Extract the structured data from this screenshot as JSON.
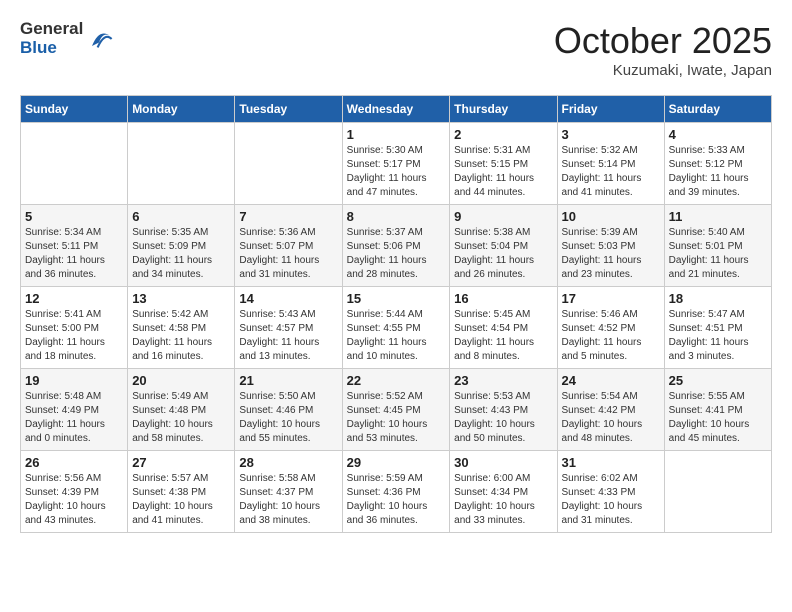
{
  "header": {
    "logo_line1": "General",
    "logo_line2": "Blue",
    "month": "October 2025",
    "location": "Kuzumaki, Iwate, Japan"
  },
  "days_of_week": [
    "Sunday",
    "Monday",
    "Tuesday",
    "Wednesday",
    "Thursday",
    "Friday",
    "Saturday"
  ],
  "weeks": [
    [
      {
        "num": "",
        "info": ""
      },
      {
        "num": "",
        "info": ""
      },
      {
        "num": "",
        "info": ""
      },
      {
        "num": "1",
        "info": "Sunrise: 5:30 AM\nSunset: 5:17 PM\nDaylight: 11 hours\nand 47 minutes."
      },
      {
        "num": "2",
        "info": "Sunrise: 5:31 AM\nSunset: 5:15 PM\nDaylight: 11 hours\nand 44 minutes."
      },
      {
        "num": "3",
        "info": "Sunrise: 5:32 AM\nSunset: 5:14 PM\nDaylight: 11 hours\nand 41 minutes."
      },
      {
        "num": "4",
        "info": "Sunrise: 5:33 AM\nSunset: 5:12 PM\nDaylight: 11 hours\nand 39 minutes."
      }
    ],
    [
      {
        "num": "5",
        "info": "Sunrise: 5:34 AM\nSunset: 5:11 PM\nDaylight: 11 hours\nand 36 minutes."
      },
      {
        "num": "6",
        "info": "Sunrise: 5:35 AM\nSunset: 5:09 PM\nDaylight: 11 hours\nand 34 minutes."
      },
      {
        "num": "7",
        "info": "Sunrise: 5:36 AM\nSunset: 5:07 PM\nDaylight: 11 hours\nand 31 minutes."
      },
      {
        "num": "8",
        "info": "Sunrise: 5:37 AM\nSunset: 5:06 PM\nDaylight: 11 hours\nand 28 minutes."
      },
      {
        "num": "9",
        "info": "Sunrise: 5:38 AM\nSunset: 5:04 PM\nDaylight: 11 hours\nand 26 minutes."
      },
      {
        "num": "10",
        "info": "Sunrise: 5:39 AM\nSunset: 5:03 PM\nDaylight: 11 hours\nand 23 minutes."
      },
      {
        "num": "11",
        "info": "Sunrise: 5:40 AM\nSunset: 5:01 PM\nDaylight: 11 hours\nand 21 minutes."
      }
    ],
    [
      {
        "num": "12",
        "info": "Sunrise: 5:41 AM\nSunset: 5:00 PM\nDaylight: 11 hours\nand 18 minutes."
      },
      {
        "num": "13",
        "info": "Sunrise: 5:42 AM\nSunset: 4:58 PM\nDaylight: 11 hours\nand 16 minutes."
      },
      {
        "num": "14",
        "info": "Sunrise: 5:43 AM\nSunset: 4:57 PM\nDaylight: 11 hours\nand 13 minutes."
      },
      {
        "num": "15",
        "info": "Sunrise: 5:44 AM\nSunset: 4:55 PM\nDaylight: 11 hours\nand 10 minutes."
      },
      {
        "num": "16",
        "info": "Sunrise: 5:45 AM\nSunset: 4:54 PM\nDaylight: 11 hours\nand 8 minutes."
      },
      {
        "num": "17",
        "info": "Sunrise: 5:46 AM\nSunset: 4:52 PM\nDaylight: 11 hours\nand 5 minutes."
      },
      {
        "num": "18",
        "info": "Sunrise: 5:47 AM\nSunset: 4:51 PM\nDaylight: 11 hours\nand 3 minutes."
      }
    ],
    [
      {
        "num": "19",
        "info": "Sunrise: 5:48 AM\nSunset: 4:49 PM\nDaylight: 11 hours\nand 0 minutes."
      },
      {
        "num": "20",
        "info": "Sunrise: 5:49 AM\nSunset: 4:48 PM\nDaylight: 10 hours\nand 58 minutes."
      },
      {
        "num": "21",
        "info": "Sunrise: 5:50 AM\nSunset: 4:46 PM\nDaylight: 10 hours\nand 55 minutes."
      },
      {
        "num": "22",
        "info": "Sunrise: 5:52 AM\nSunset: 4:45 PM\nDaylight: 10 hours\nand 53 minutes."
      },
      {
        "num": "23",
        "info": "Sunrise: 5:53 AM\nSunset: 4:43 PM\nDaylight: 10 hours\nand 50 minutes."
      },
      {
        "num": "24",
        "info": "Sunrise: 5:54 AM\nSunset: 4:42 PM\nDaylight: 10 hours\nand 48 minutes."
      },
      {
        "num": "25",
        "info": "Sunrise: 5:55 AM\nSunset: 4:41 PM\nDaylight: 10 hours\nand 45 minutes."
      }
    ],
    [
      {
        "num": "26",
        "info": "Sunrise: 5:56 AM\nSunset: 4:39 PM\nDaylight: 10 hours\nand 43 minutes."
      },
      {
        "num": "27",
        "info": "Sunrise: 5:57 AM\nSunset: 4:38 PM\nDaylight: 10 hours\nand 41 minutes."
      },
      {
        "num": "28",
        "info": "Sunrise: 5:58 AM\nSunset: 4:37 PM\nDaylight: 10 hours\nand 38 minutes."
      },
      {
        "num": "29",
        "info": "Sunrise: 5:59 AM\nSunset: 4:36 PM\nDaylight: 10 hours\nand 36 minutes."
      },
      {
        "num": "30",
        "info": "Sunrise: 6:00 AM\nSunset: 4:34 PM\nDaylight: 10 hours\nand 33 minutes."
      },
      {
        "num": "31",
        "info": "Sunrise: 6:02 AM\nSunset: 4:33 PM\nDaylight: 10 hours\nand 31 minutes."
      },
      {
        "num": "",
        "info": ""
      }
    ]
  ]
}
